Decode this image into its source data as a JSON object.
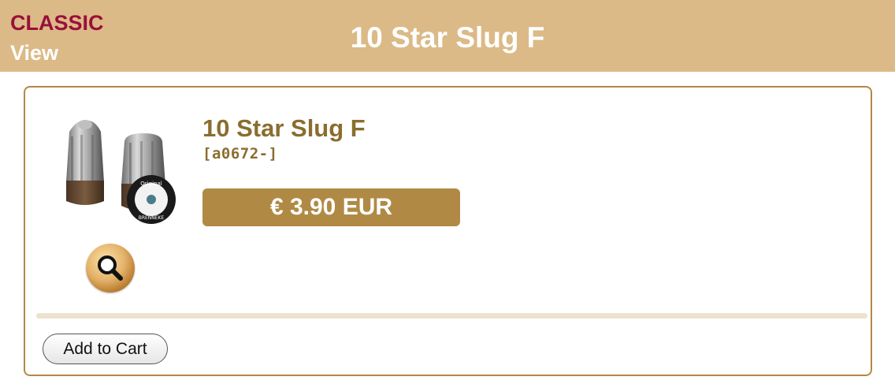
{
  "header": {
    "classic_label": "CLASSIC",
    "view_label": "View",
    "title": "10 Star Slug F",
    "background_color": "#dbba87"
  },
  "product": {
    "name": "10 Star Slug F",
    "code": "[a0672-]",
    "price": "€ 3.90 EUR",
    "zoom_icon": "magnifier-icon",
    "accent_color": "#b08a45",
    "name_color": "#8a6d2f",
    "image_stamp_text": "Original BRENNEKE Germany 12"
  },
  "cart": {
    "add_label": "Add to Cart"
  }
}
